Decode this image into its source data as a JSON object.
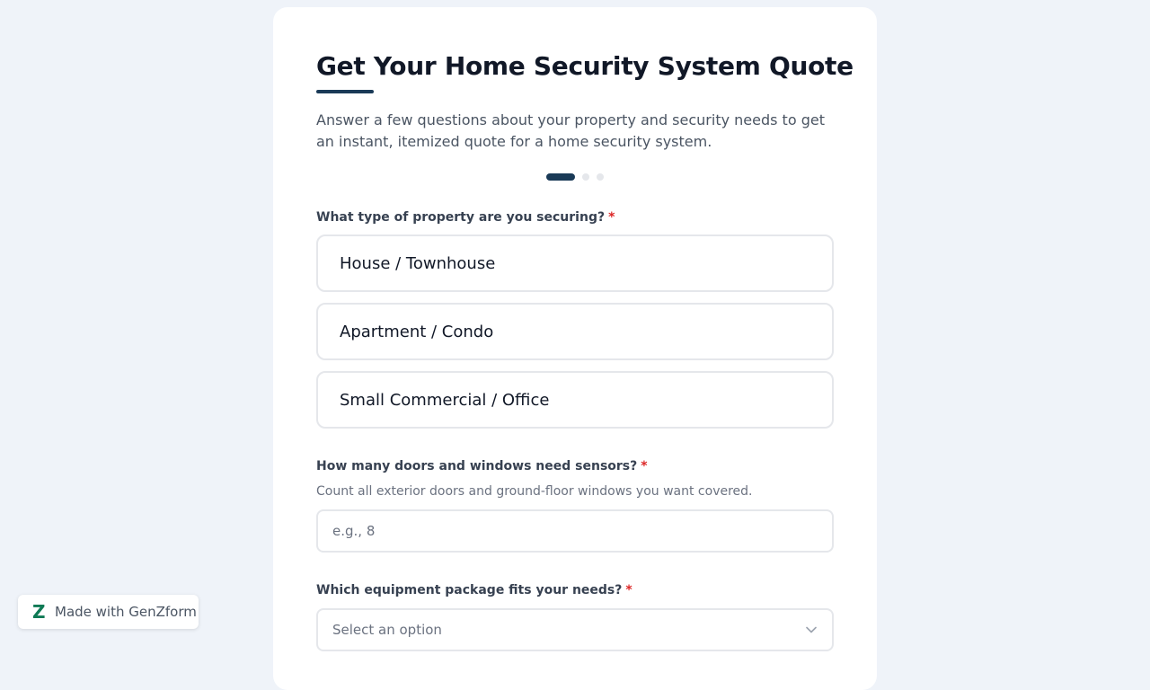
{
  "form": {
    "title": "Get Your Home Security System Quote",
    "subtitle": "Answer a few questions about your property and security needs to get an instant, itemized quote for a home security system.",
    "progress": {
      "current_step": 1,
      "total_steps": 3
    },
    "required_marker": "*"
  },
  "questions": {
    "property_type": {
      "label": "What type of property are you securing?",
      "options": [
        "House / Townhouse",
        "Apartment / Condo",
        "Small Commercial / Office"
      ]
    },
    "sensors": {
      "label": "How many doors and windows need sensors?",
      "helper": "Count all exterior doors and ground-floor windows you want covered.",
      "placeholder": "e.g., 8",
      "value": ""
    },
    "package": {
      "label": "Which equipment package fits your needs?",
      "selected": "Select an option"
    }
  },
  "badge": {
    "logo": "Z",
    "text": "Made with GenZform"
  },
  "colors": {
    "accent": "#1a3a57",
    "required": "#dc2626",
    "brand_logo": "#0f7a55",
    "background": "#eff3f9"
  }
}
